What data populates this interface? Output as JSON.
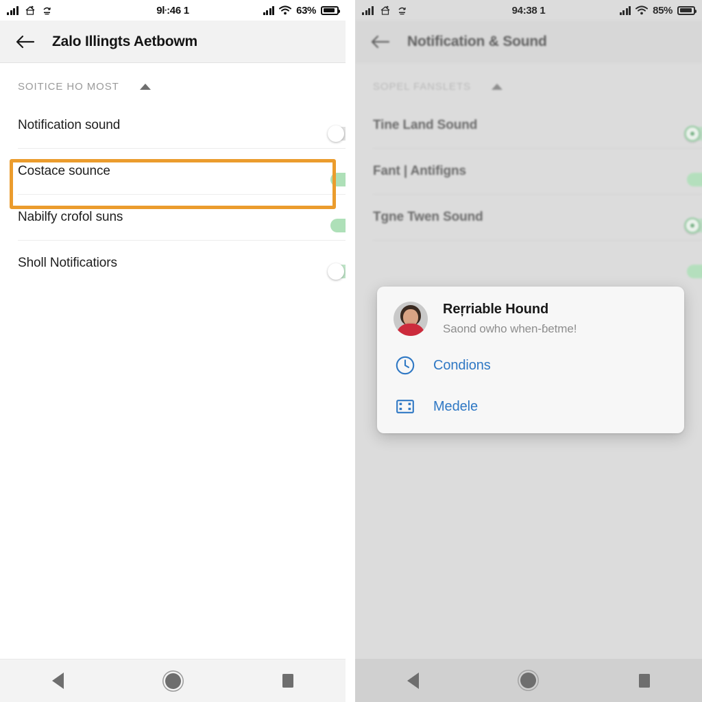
{
  "left_phone": {
    "status_bar": {
      "time": "9ŀ:46 1",
      "battery_pct": "63%",
      "icons": [
        "signal-bars-icon",
        "home-upload-icon",
        "sync-icon",
        "signal-icon",
        "wifi-icon",
        "battery-icon"
      ]
    },
    "app_bar": {
      "back_label": "back-arrow-icon",
      "title": "Zalo Illingts Aetbowm"
    },
    "section": {
      "title": "SOITICE HO MOST",
      "collapse_icon": "caret-up-icon"
    },
    "rows": [
      {
        "label": "Notification sound",
        "toggle": "off"
      },
      {
        "label": "Costace sounce",
        "toggle": "on",
        "highlighted": true
      },
      {
        "label": "Nabilfy crofol suns",
        "toggle": "on"
      },
      {
        "label": "Sholl Notificatiors",
        "toggle": "off-green"
      }
    ],
    "nav_bar": {
      "back": "nav-back-icon",
      "home": "nav-home-icon",
      "recents": "nav-recents-icon"
    }
  },
  "right_phone": {
    "status_bar": {
      "time": "94:38 1",
      "battery_pct": "85%",
      "icons": [
        "signal-bars-icon",
        "home-upload-icon",
        "sync-icon",
        "signal-icon",
        "wifi-icon",
        "battery-icon"
      ]
    },
    "app_bar": {
      "back_label": "back-arrow-icon",
      "title": "Notification & Sound"
    },
    "section": {
      "title": "SOPEL FANSLETS",
      "collapse_icon": "caret-up-icon"
    },
    "rows": [
      {
        "label": "Tine Land Sound",
        "toggle": "off-green"
      },
      {
        "label": "Fant | Antifigns",
        "toggle": "on"
      },
      {
        "label": "Tgne Twen Sound",
        "toggle": "off-green"
      },
      {
        "label": "",
        "toggle": "on"
      }
    ],
    "dialog": {
      "avatar": "user-avatar",
      "title": "Reŗriable Hound",
      "subtitle": "Saond owho when-ɓetme!",
      "actions": [
        {
          "icon": "clock-icon",
          "label": "Condions"
        },
        {
          "icon": "film-strip-icon",
          "label": "Medele"
        }
      ]
    },
    "nav_bar": {
      "back": "nav-back-icon",
      "home": "nav-home-icon",
      "recents": "nav-recents-icon"
    }
  },
  "colors": {
    "highlight_orange": "#eb9c2d",
    "toggle_on_green": "#2f9e44",
    "toggle_track_green": "#aee0b8",
    "link_blue": "#2f78c4",
    "panel_left_bg": "#ffffff",
    "panel_right_bg": "#dcdcdc"
  }
}
